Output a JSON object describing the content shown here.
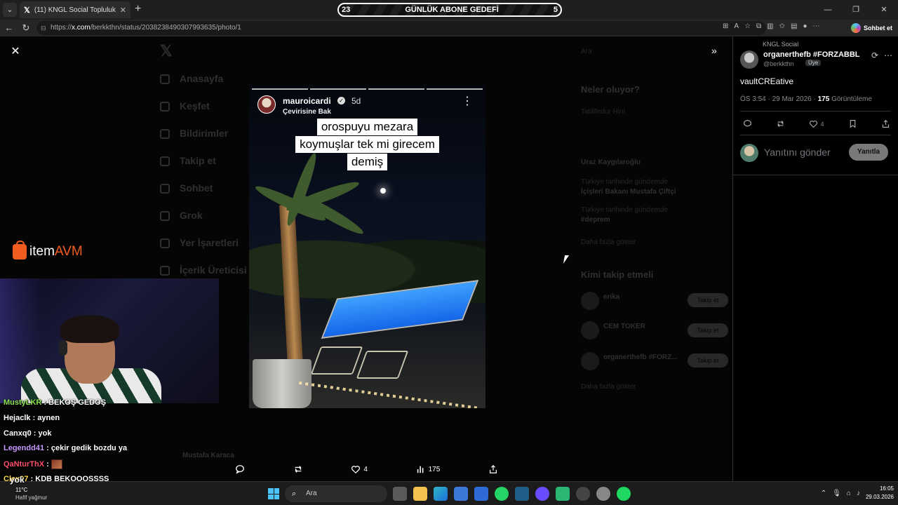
{
  "browser": {
    "tab_title": "(11) KNGL Social Topluluk / X",
    "url_prefix": "https://",
    "url_host": "x.com",
    "url_path": "/berkkthn/status/2038238490307993635/photo/1",
    "copilot_label": "Sohbet et"
  },
  "subscriber_goal": {
    "current": "23",
    "title": "GÜNLÜK ABONE GEDEFİ",
    "target": "5"
  },
  "background_page": {
    "nav": [
      "Anasayfa",
      "Keşfet",
      "Bildirimler",
      "Takip et",
      "Sohbet",
      "Grok",
      "Yer İşaretleri",
      "İçerik Üreticisi Stüdyosu"
    ],
    "search_placeholder": "Ara",
    "trends_title": "Neler oluyor?",
    "trends": [
      {
        "meta": "Tatilifedur Hini",
        "topic": "Uraz Kaygılaroğlu"
      },
      {
        "meta": "Türkiye tarihinde gündemde",
        "topic": "İçişleri Bakanı Mustafa Çiftçi"
      },
      {
        "meta": "Türkiye tarihinde gündemde",
        "topic": "#deprem"
      },
      {
        "meta": "",
        "topic": "Daha fazla göster"
      }
    ],
    "who_to_follow_title": "Kimi takip etmeli",
    "suggestions": [
      {
        "name": "erika",
        "button": "Takip et"
      },
      {
        "name": "CEM TOKER",
        "button": "Takip et"
      },
      {
        "name": "organerthefb #FORZ...",
        "button": "Takip et"
      }
    ],
    "show_more": "Daha fazla göster",
    "bottom_user": "Mustafa Karaca"
  },
  "story": {
    "username": "mauroicardi",
    "age": "5d",
    "translate_label": "Çevirisine Bak",
    "caption_lines": [
      "orospuyu mezara",
      "koymuşlar tek mi girecem",
      "demiş"
    ]
  },
  "media_actions": {
    "likes": "4",
    "views": "175"
  },
  "post": {
    "community": "KNGL Social",
    "display_name": "organerthefb #FORZABBL",
    "handle": "@berkkthn",
    "role_badge": "Üye",
    "text": "vaultCREative",
    "time": "ÖS 3:54 · 29 Mar 2026 · ",
    "views_count": "175",
    "views_label": " Görüntüleme",
    "likes": "4",
    "reply_placeholder": "Yanıtını gönder",
    "reply_button": "Yanıtla"
  },
  "overlay": {
    "brand_item": "item",
    "brand_avm": "AVM"
  },
  "chat": [
    {
      "user": "MustyLKR",
      "color": "#8be04e",
      "message": "BEKOŞ GEDOŞ"
    },
    {
      "user": "Hejaclk",
      "color": "#ffffff",
      "message": "aynen"
    },
    {
      "user": "Canxq0",
      "color": "#ffffff",
      "message": "yok"
    },
    {
      "user": "Legendd41",
      "color": "#c79bff",
      "message": "çekir gedik bozdu ya"
    },
    {
      "user": "QaNturThX",
      "color": "#ff4f6a",
      "message": ""
    },
    {
      "user": "Clex07",
      "color": "#ffd84a",
      "message": "KDB BEKOOOŞŞŞŞ"
    }
  ],
  "chat_partial": "yok",
  "taskbar": {
    "temperature": "11°C",
    "weather": "Hafif yağmur",
    "search_label": "Ara",
    "time": "16:05",
    "date": "29.03.2026"
  },
  "colors": {
    "accent_orange": "#f25c1f",
    "pool_blue": "#2a86ff",
    "taskbar": "#1c1c1c"
  }
}
